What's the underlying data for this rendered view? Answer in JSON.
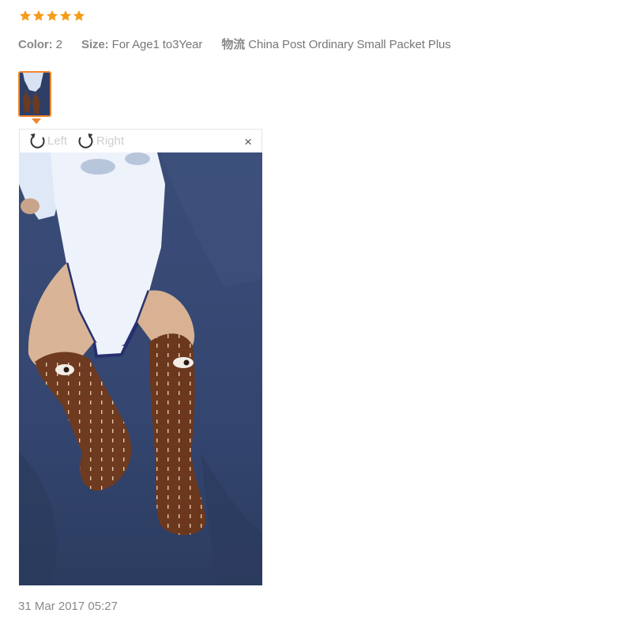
{
  "review": {
    "rating": 5,
    "color_label": "Color:",
    "color_value": "2",
    "size_label": "Size:",
    "size_value": "For Age1 to3Year",
    "shipping_label": "物流",
    "shipping_value": "China Post Ordinary Small Packet Plus",
    "date": "31 Mar 2017 05:27"
  },
  "viewer": {
    "rotate_left_label": "Left",
    "rotate_right_label": "Right",
    "close_label": "×"
  },
  "icons": {
    "star": "star-icon",
    "rotate_left": "rotate-left-icon",
    "rotate_right": "rotate-right-icon",
    "close": "close-icon"
  },
  "colors": {
    "star": "#f59c1a",
    "thumbnail_border": "#f0862e",
    "rotate_label": "#cfcfcf"
  }
}
